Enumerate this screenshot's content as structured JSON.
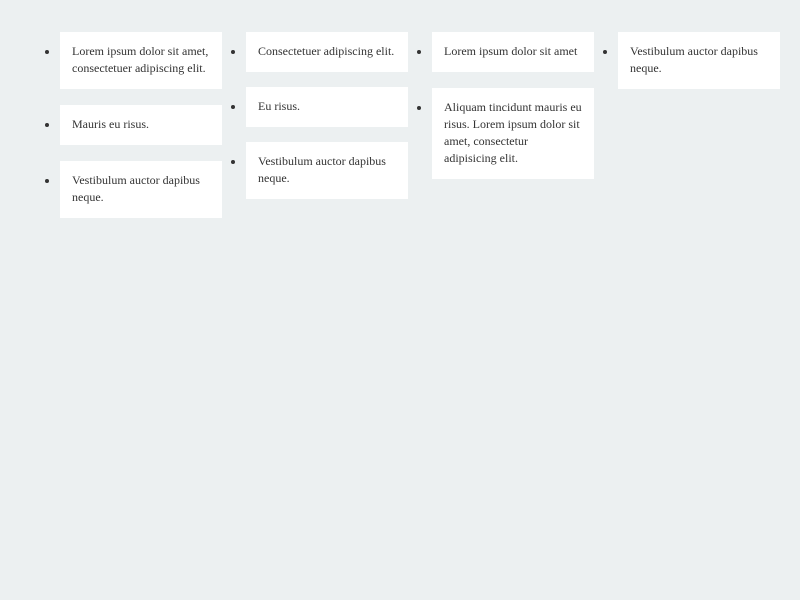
{
  "columns": [
    {
      "items": [
        {
          "text": "Lorem ipsum dolor sit amet, consectetuer adipiscing elit."
        },
        {
          "text": "Mauris eu risus."
        },
        {
          "text": "Vestibulum auctor dapibus neque."
        }
      ]
    },
    {
      "items": [
        {
          "text": "Consectetuer adipiscing elit."
        },
        {
          "text": "Eu risus."
        },
        {
          "text": "Vestibulum auctor dapibus neque."
        }
      ]
    },
    {
      "items": [
        {
          "text": "Lorem ipsum dolor sit amet"
        },
        {
          "text": "Aliquam tincidunt mauris eu risus. Lorem ipsum dolor sit amet, consectetur adipisicing elit."
        }
      ]
    },
    {
      "items": [
        {
          "text": "Vestibulum auctor dapibus neque."
        }
      ]
    }
  ],
  "colors": {
    "background": "#ecf0f1",
    "card": "#ffffff",
    "text": "#333333"
  }
}
